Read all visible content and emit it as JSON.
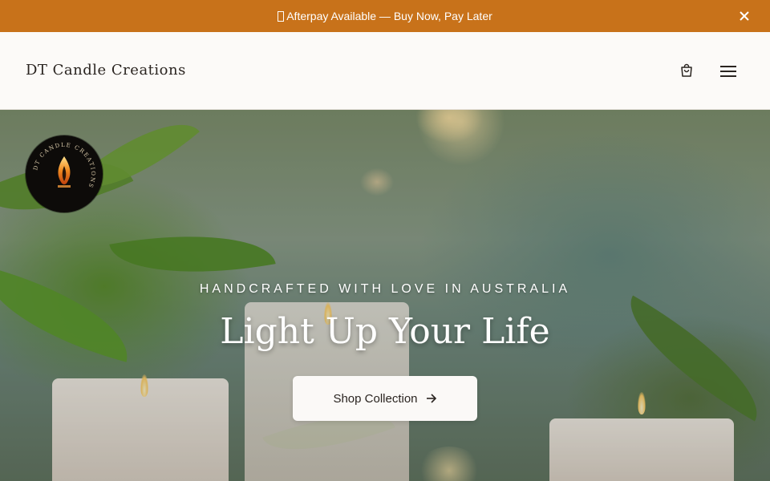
{
  "announcement": {
    "text": "Afterpay Available — Buy Now, Pay Later",
    "icon": "afterpay-icon"
  },
  "header": {
    "brand": "DT Candle Creations",
    "icons": [
      "cart-icon",
      "menu-icon"
    ]
  },
  "hero": {
    "logo_text": "DT CANDLE CREATIONS",
    "kicker": "HANDCRAFTED WITH LOVE IN AUSTRALIA",
    "headline": "Light Up Your Life",
    "cta_label": "Shop Collection"
  },
  "colors": {
    "announcement_bg": "#c8721a",
    "header_bg": "#fcfaf8",
    "button_bg": "#fbf9f7",
    "text_dark": "#2a2420"
  }
}
